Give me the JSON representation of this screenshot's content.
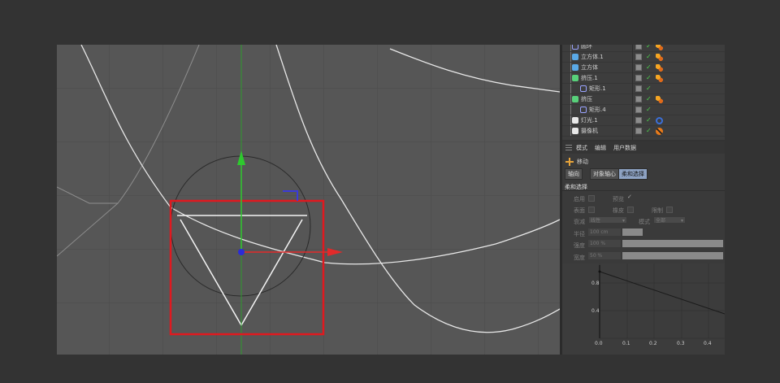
{
  "objects": [
    {
      "name": "圆环",
      "icon": "circle-spline-icon",
      "color": "#9aa3ff",
      "depth": 0,
      "tag": "phong-tag-icon"
    },
    {
      "name": "立方体.1",
      "icon": "cube-icon",
      "color": "#5aa9e6",
      "depth": 0,
      "tag": "phong-tag-icon"
    },
    {
      "name": "立方体",
      "icon": "cube-icon",
      "color": "#5aa9e6",
      "depth": 0,
      "tag": "phong-tag-icon"
    },
    {
      "name": "挤压.1",
      "icon": "extrude-icon",
      "color": "#58d07a",
      "depth": 0,
      "tag": "phong-tag-icon"
    },
    {
      "name": "矩形.1",
      "icon": "rectangle-spline-icon",
      "color": "#9aa3ff",
      "depth": 1,
      "tag": ""
    },
    {
      "name": "挤压",
      "icon": "extrude-icon",
      "color": "#58d07a",
      "depth": 0,
      "tag": "phong-tag-icon"
    },
    {
      "name": "矩形.4",
      "icon": "rectangle-spline-icon",
      "color": "#9aa3ff",
      "depth": 1,
      "tag": ""
    },
    {
      "name": "灯光.1",
      "icon": "light-icon",
      "color": "#e8e8e8",
      "depth": 0,
      "tag": "light-target-icon"
    },
    {
      "name": "摄像机",
      "icon": "camera-icon",
      "color": "#e8e8e8",
      "depth": 0,
      "tag": "camera-protection-icon"
    }
  ],
  "attr": {
    "menu": {
      "mode": "模式",
      "edit": "编辑",
      "userdata": "用户数据"
    },
    "tool_title": "移动",
    "tabs": [
      "轴向",
      "对象轴心",
      "柔和选择"
    ],
    "active_tab": 2,
    "section_title": "柔和选择",
    "enable_label": "启用",
    "preview_label": "预览",
    "surface_label": "表面",
    "rubber_label": "橡皮",
    "restrict_label": "限制",
    "falloff_label": "衰减",
    "falloff_value": "线性",
    "mode_label": "模式",
    "mode_value": "全部",
    "radius_label": "半径",
    "radius_value": "100 cm",
    "radius_fill": 0.2,
    "strength_label": "强度",
    "strength_value": "100 %",
    "strength_fill": 1.0,
    "width_label": "宽度",
    "width_value": "50 %",
    "width_fill": 1.0
  },
  "graph": {
    "y_ticks": [
      "0.8",
      "0.4"
    ],
    "x_ticks": [
      "0.0",
      "0.1",
      "0.2",
      "0.3",
      "0.4"
    ]
  },
  "colors": {
    "viewport_bg": "#565656",
    "selection_box": "#e0191f",
    "axis_y": "#2ec92e",
    "axis_x": "#e22a2a",
    "axis_z": "#2b2bd8"
  }
}
